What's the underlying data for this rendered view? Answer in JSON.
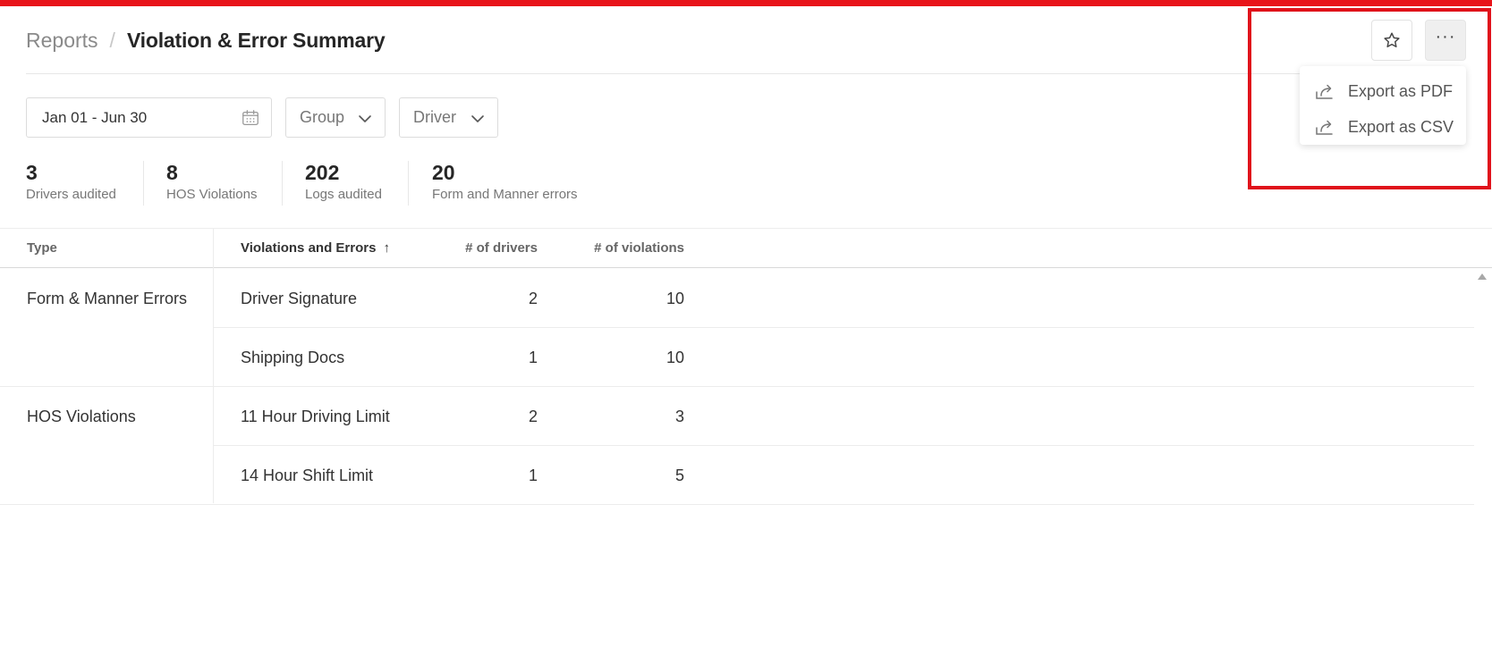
{
  "breadcrumb": {
    "root": "Reports",
    "separator": "/",
    "current": "Violation & Error Summary"
  },
  "header_actions": {
    "more_label": "···"
  },
  "export_menu": {
    "items": [
      {
        "label": "Export as PDF",
        "icon": "export-icon"
      },
      {
        "label": "Export as CSV",
        "icon": "export-icon"
      }
    ]
  },
  "filters": {
    "date_range": "Jan 01 - Jun 30",
    "group": "Group",
    "driver": "Driver"
  },
  "stats": [
    {
      "value": "3",
      "label": "Drivers audited"
    },
    {
      "value": "8",
      "label": "HOS Violations"
    },
    {
      "value": "202",
      "label": "Logs audited"
    },
    {
      "value": "20",
      "label": "Form and Manner errors"
    }
  ],
  "table": {
    "headers": {
      "type": "Type",
      "violations": "Violations and Errors",
      "sort_indicator": "↑",
      "drivers": "# of drivers",
      "count": "# of violations"
    },
    "groups": [
      {
        "type": "Form & Manner Errors",
        "rows": [
          {
            "name": "Driver Signature",
            "drivers": "2",
            "violations": "10"
          },
          {
            "name": "Shipping Docs",
            "drivers": "1",
            "violations": "10"
          }
        ]
      },
      {
        "type": "HOS Violations",
        "rows": [
          {
            "name": "11 Hour Driving Limit",
            "drivers": "2",
            "violations": "3"
          },
          {
            "name": "14 Hour Shift Limit",
            "drivers": "1",
            "violations": "5"
          }
        ]
      }
    ]
  },
  "colors": {
    "accent_red": "#e8141a",
    "border": "#dcdcdc",
    "muted_text": "#777777"
  }
}
